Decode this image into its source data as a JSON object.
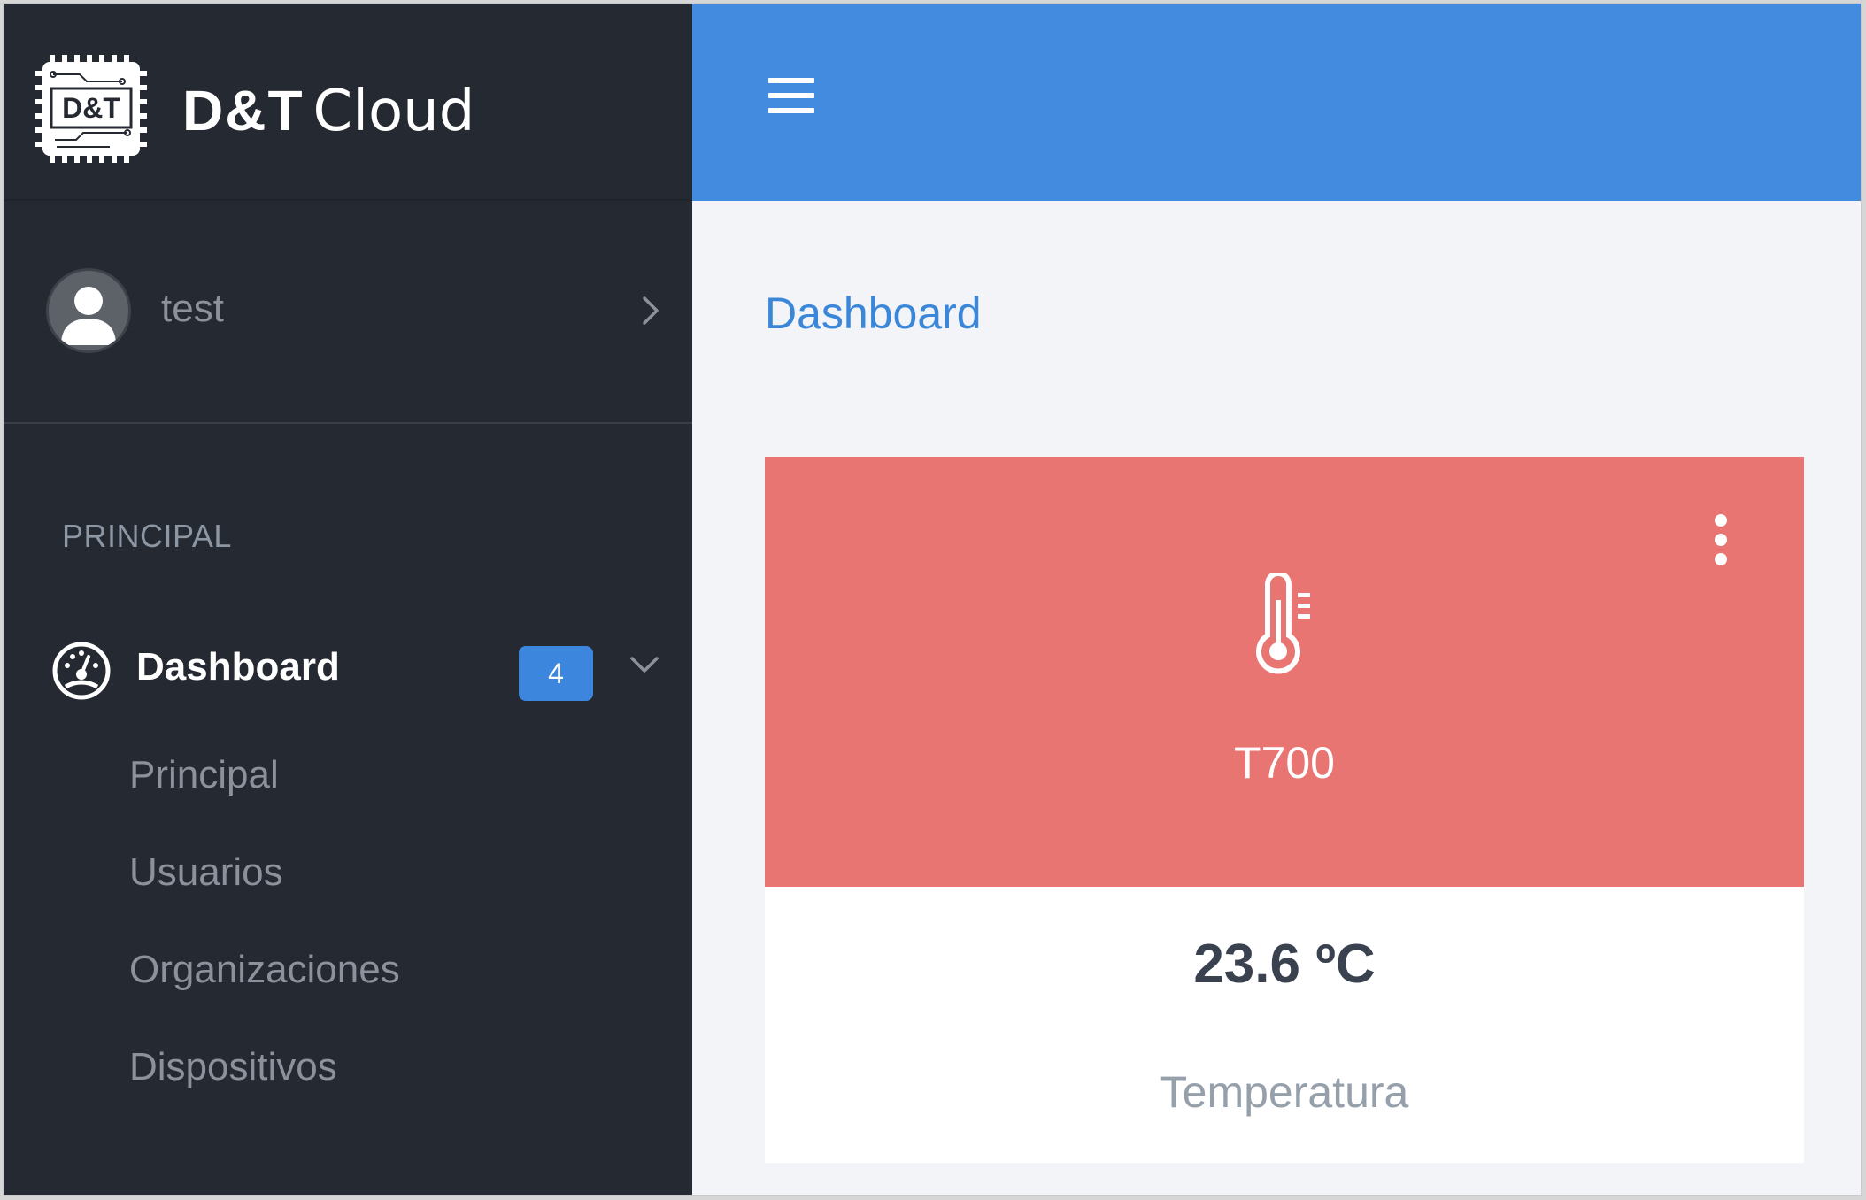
{
  "brand": {
    "logo_text": "D&T",
    "name_bold": "D&T",
    "name_light": "Cloud"
  },
  "user": {
    "name": "test"
  },
  "sidebar": {
    "section_label": "PRINCIPAL",
    "dashboard": {
      "label": "Dashboard",
      "badge": "4"
    },
    "items": [
      {
        "label": "Principal"
      },
      {
        "label": "Usuarios"
      },
      {
        "label": "Organizaciones"
      },
      {
        "label": "Dispositivos"
      }
    ]
  },
  "main": {
    "title": "Dashboard",
    "card": {
      "device": "T700",
      "value": "23.6 ºC",
      "metric": "Temperatura",
      "accent": "#e87571",
      "icon": "thermometer-icon"
    }
  },
  "colors": {
    "sidebar_bg": "#252932",
    "topbar_bg": "#428bdf",
    "badge_bg": "#3d86de",
    "title_color": "#3a86d8"
  }
}
